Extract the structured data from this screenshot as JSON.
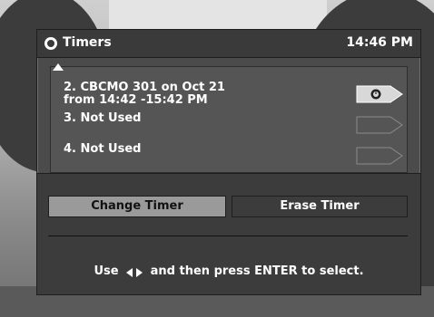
{
  "header": {
    "title": "Timers",
    "time": "14:46 PM",
    "icon": "clock-icon"
  },
  "timers": [
    {
      "label": "2. CBCMO 301 on Oct 21",
      "label2": "from 14:42 -15:42 PM",
      "icon": "clock-icon"
    },
    {
      "label": "3. Not Used",
      "label2": ""
    },
    {
      "label": "4. Not Used",
      "label2": ""
    }
  ],
  "buttons": {
    "change_label": "Change Timer",
    "erase_label": "Erase Timer"
  },
  "hint": {
    "before": "Use",
    "after": "and then press ENTER to select."
  }
}
